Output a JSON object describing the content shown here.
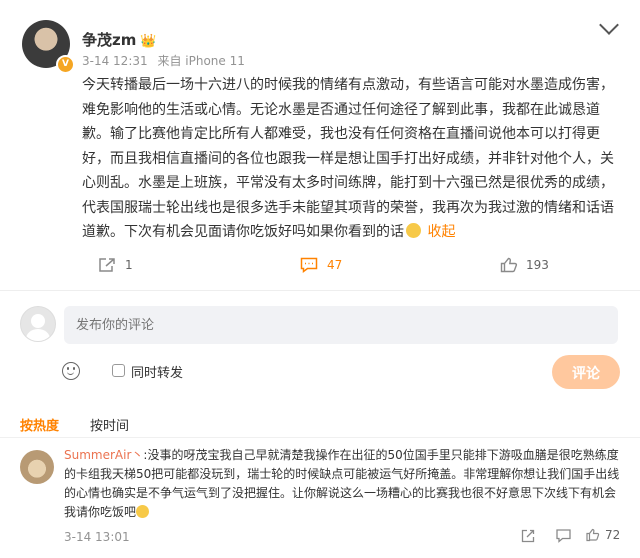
{
  "post": {
    "author": "争茂zm",
    "author_badge": "👑",
    "verified_icon": "v-badge-icon",
    "date": "3-14 12:31",
    "source": "来自 iPhone 11",
    "body_before_emoji": "今天转播最后一场十六进八的时候我的情绪有点激动，有些语言可能对水墨造成伤害，难免影响他的生活或心情。无论水墨是否通过任何途径了解到此事，我都在此诚恳道歉。输了比赛他肯定比所有人都难受，我也没有任何资格在直播间说他本可以打得更好，而且我相信直播间的各位也跟我一样是想让国手打出好成绩，并非针对他个人，关心则乱。水墨是上班族，平常没有太多时间练牌，能打到十六强已然是很优秀的成绩，代表国服瑞士轮出线也是很多选手未能望其项背的荣誉，我再次为我过激的情绪和话语道歉。下次有机会见面请你吃饭好吗如果你看到的话",
    "collapse_label": "收起",
    "repost_count": "1",
    "comment_count": "47",
    "like_count": "193"
  },
  "composer": {
    "placeholder": "发布你的评论",
    "also_repost_label": "同时转发",
    "submit_label": "评论"
  },
  "sort": {
    "by_hot": "按热度",
    "by_time": "按时间"
  },
  "comment": {
    "user": "SummerAir丶",
    "text": ":没事的呀茂宝我自己早就清楚我操作在出征的50位国手里只能排下游吸血膳是很吃熟练度的卡组我天梯50把可能都没玩到，瑞士轮的时候缺点可能被运气好所掩盖。非常理解你想让我们国手出线的心情也确实是不争气运气到了没把握住。让你解说这么一场糟心的比赛我也很不好意思下次线下有机会我请你吃饭吧",
    "date": "3-14 13:01",
    "like_count": "72"
  },
  "colors": {
    "accent": "#ff8200",
    "username": "#eb7350",
    "submit_disabled": "#ffc89e"
  }
}
